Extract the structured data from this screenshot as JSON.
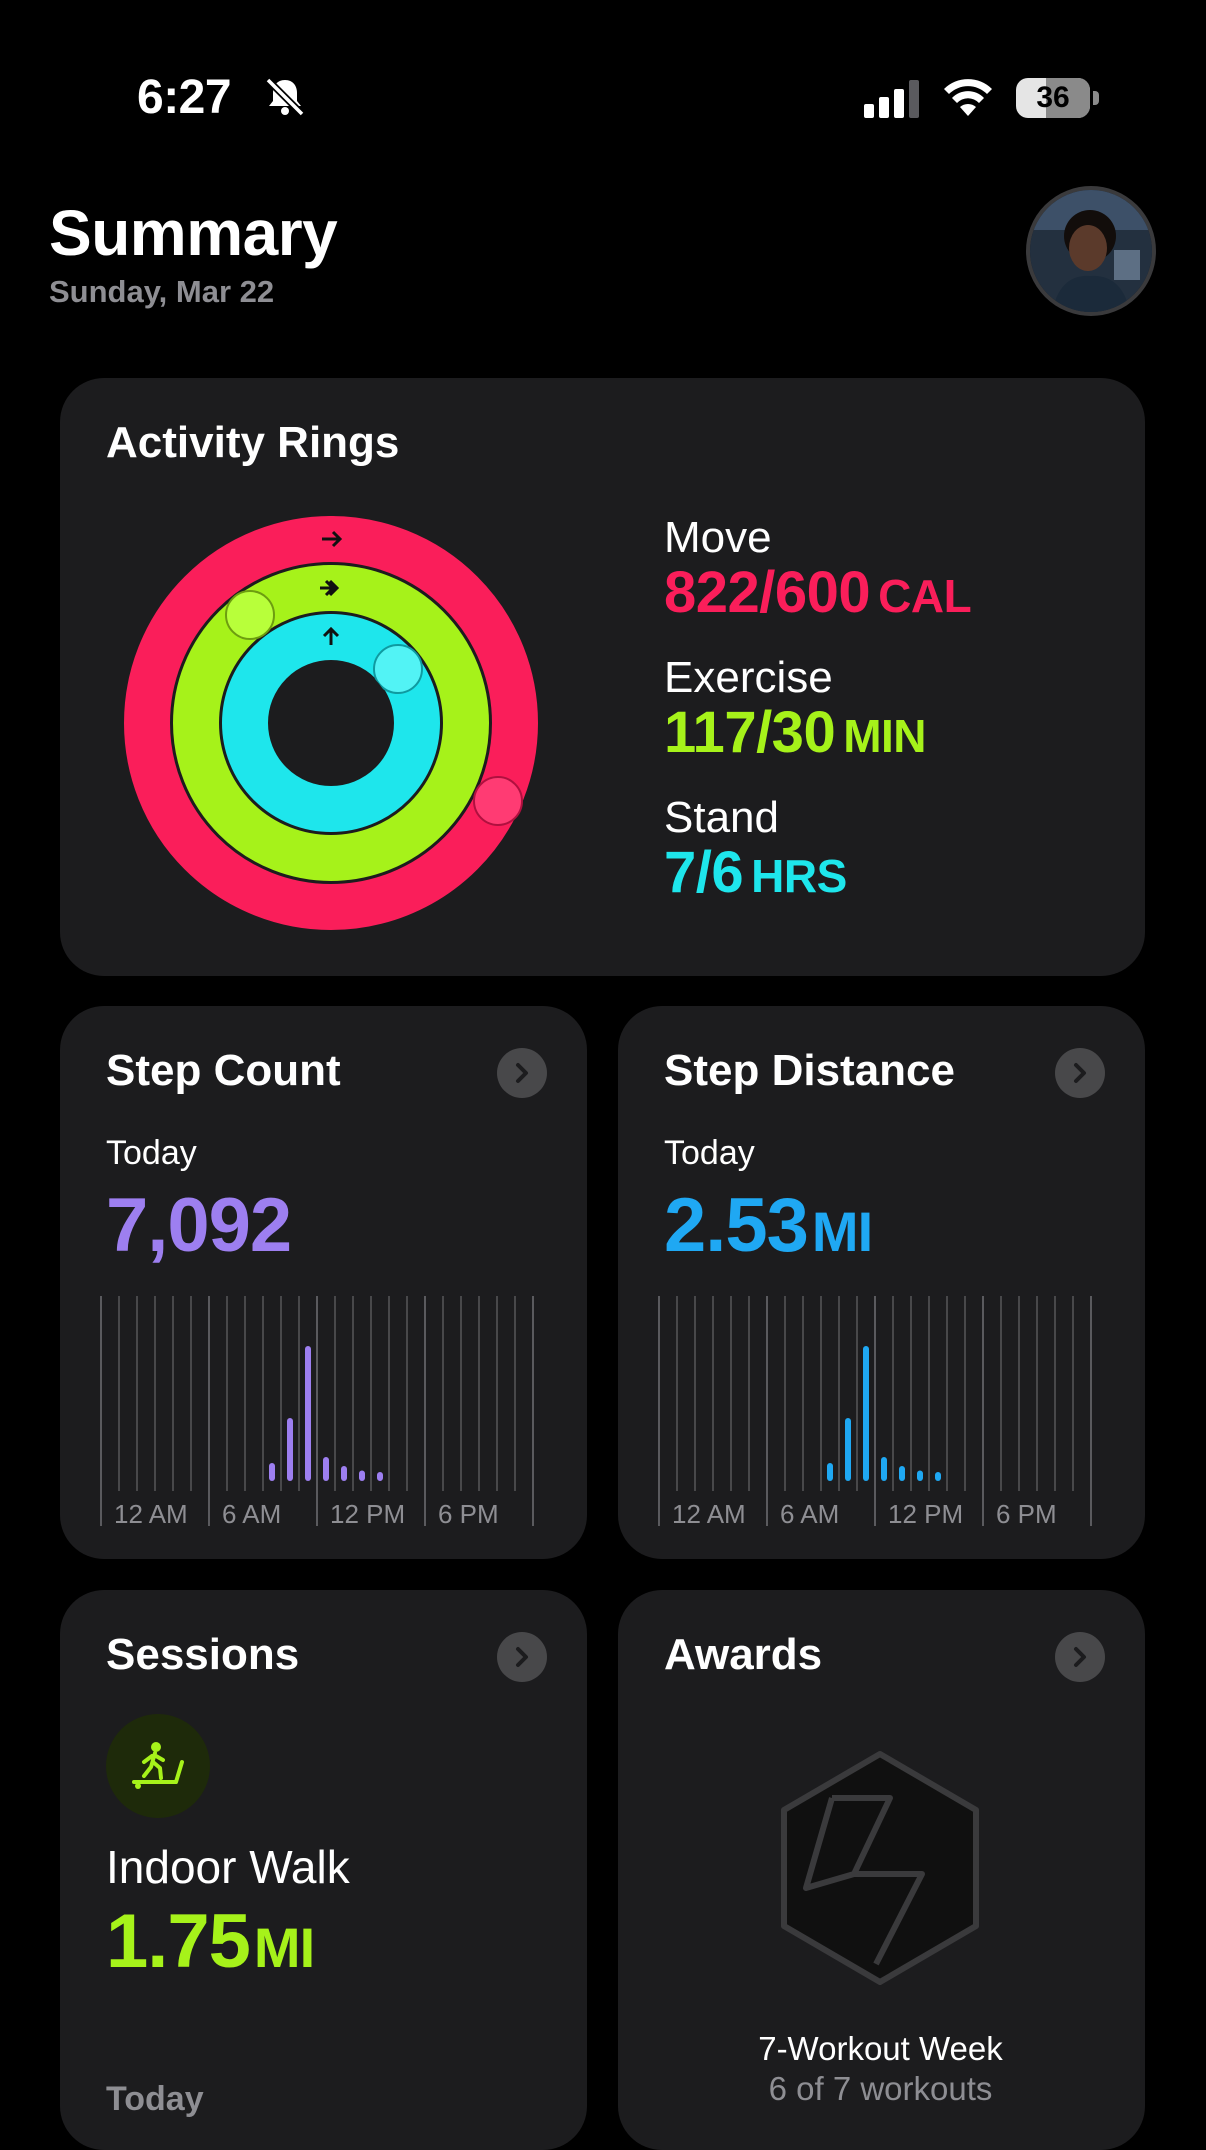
{
  "status_bar": {
    "time": "6:27",
    "battery": "36"
  },
  "header": {
    "title": "Summary",
    "date": "Sunday, Mar 22"
  },
  "activity": {
    "title": "Activity Rings",
    "move": {
      "label": "Move",
      "value": "822/600",
      "unit": "CAL",
      "color": "#fa1e5a",
      "current": 822,
      "goal": 600
    },
    "exercise": {
      "label": "Exercise",
      "value": "117/30",
      "unit": "MIN",
      "color": "#a6f21a",
      "current": 117,
      "goal": 30
    },
    "stand": {
      "label": "Stand",
      "value": "7/6",
      "unit": "HRS",
      "color": "#1ee6ec",
      "current": 7,
      "goal": 6
    }
  },
  "step_count": {
    "title": "Step Count",
    "period": "Today",
    "value": "7,092",
    "color": "#9d7ff0",
    "axis_labels": [
      "12 AM",
      "6 AM",
      "12 PM",
      "6 PM"
    ],
    "chart_data": {
      "type": "bar",
      "x": [
        "9",
        "10",
        "11",
        "12",
        "13",
        "14",
        "15",
        "16"
      ],
      "values": [
        12,
        42,
        90,
        16,
        10,
        7,
        6,
        0
      ],
      "ylim": [
        0,
        100
      ]
    }
  },
  "step_distance": {
    "title": "Step Distance",
    "period": "Today",
    "value": "2.53",
    "unit": "MI",
    "color": "#1fa8f3",
    "axis_labels": [
      "12 AM",
      "6 AM",
      "12 PM",
      "6 PM"
    ],
    "chart_data": {
      "type": "bar",
      "x": [
        "9",
        "10",
        "11",
        "12",
        "13",
        "14",
        "15",
        "16"
      ],
      "values": [
        12,
        42,
        90,
        16,
        10,
        7,
        6,
        0
      ],
      "ylim": [
        0,
        100
      ]
    }
  },
  "sessions": {
    "title": "Sessions",
    "icon": "treadmill-walk-icon",
    "name": "Indoor Walk",
    "value": "1.75",
    "unit": "MI",
    "when": "Today"
  },
  "awards": {
    "title": "Awards",
    "badge": "hexagon-badge-icon",
    "award_name": "7-Workout Week",
    "award_progress": "6 of 7 workouts"
  }
}
